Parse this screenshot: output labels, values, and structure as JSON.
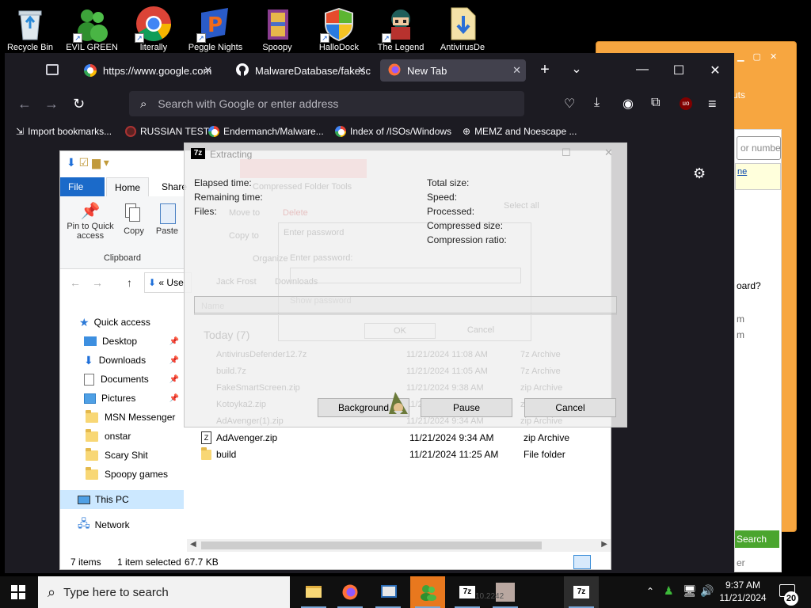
{
  "desktop": {
    "icons": [
      {
        "name": "Recycle Bin",
        "icon": "recycle-bin-icon"
      },
      {
        "name": "EVIL GREEN",
        "icon": "msn-buddy-icon"
      },
      {
        "name": "literally",
        "icon": "chrome-icon"
      },
      {
        "name": "Peggle Nights",
        "icon": "peggle-icon"
      },
      {
        "name": "Spoopy",
        "icon": "winrar-icon"
      },
      {
        "name": "HalloDock",
        "icon": "windows-shield-icon"
      },
      {
        "name": "The Legend",
        "icon": "game-character-icon"
      },
      {
        "name": "AntivirusDe",
        "icon": "download-file-icon"
      }
    ]
  },
  "right_app": {
    "input_placeholder": "or numbe",
    "text_fragments": [
      "uts",
      "oard?",
      "m",
      "m",
      "ne"
    ],
    "search_button": "Search",
    "footer": "er"
  },
  "firefox": {
    "tabs": [
      {
        "title": "https://www.google.com",
        "icon": "google-icon",
        "active": false
      },
      {
        "title": "MalwareDatabase/fakesc",
        "icon": "github-icon",
        "active": false
      },
      {
        "title": "New Tab",
        "icon": "firefox-icon",
        "active": true
      }
    ],
    "url_placeholder": "Search with Google or enter address",
    "bookmarks": [
      {
        "label": "Import bookmarks...",
        "icon": "import-icon"
      },
      {
        "label": "RUSSIAN TEST",
        "icon": "generic-site-icon"
      },
      {
        "label": "Endermanch/Malware...",
        "icon": "google-icon"
      },
      {
        "label": "Index of /ISOs/Windows",
        "icon": "google-icon"
      },
      {
        "label": "MEMZ and Noescape ...",
        "icon": "globe-icon"
      }
    ]
  },
  "explorer": {
    "ribbon_tabs": [
      "File",
      "Home",
      "Share"
    ],
    "clipboard": {
      "pin_label": "Pin to Quick access",
      "copy_label": "Copy",
      "paste_label": "Paste",
      "group_label": "Clipboard"
    },
    "address_partial": "Use",
    "nav": {
      "quick_access": "Quick access",
      "items": [
        {
          "label": "Desktop",
          "pinned": true,
          "icon": "desktop-folder-icon"
        },
        {
          "label": "Downloads",
          "pinned": true,
          "icon": "downloads-folder-icon"
        },
        {
          "label": "Documents",
          "pinned": true,
          "icon": "documents-folder-icon"
        },
        {
          "label": "Pictures",
          "pinned": true,
          "icon": "pictures-folder-icon"
        },
        {
          "label": "MSN Messenger",
          "pinned": false,
          "icon": "folder-icon"
        },
        {
          "label": "onstar",
          "pinned": false,
          "icon": "folder-icon"
        },
        {
          "label": "Scary Shit",
          "pinned": false,
          "icon": "folder-icon"
        },
        {
          "label": "Spoopy games",
          "pinned": false,
          "icon": "folder-icon"
        }
      ],
      "this_pc": "This PC",
      "network": "Network"
    },
    "files": [
      {
        "name": "AdAvenger.zip",
        "date": "11/21/2024 9:34 AM",
        "type": "zip Archive",
        "icon": "zip-icon"
      },
      {
        "name": "build",
        "date": "11/21/2024 11:25 AM",
        "type": "File folder",
        "icon": "folder-icon"
      }
    ],
    "status": {
      "items": "7 items",
      "selected": "1 item selected",
      "size": "67.7 KB"
    }
  },
  "ghost_layer": {
    "compressed_tools": "Compressed Folder Tools",
    "move_to": "Move to",
    "delete": "Delete",
    "copy_to": "Copy to",
    "organize": "Organize",
    "select_all": "Select all",
    "path": [
      "Jack Frost",
      "Downloads"
    ],
    "column_name": "Name",
    "group": "Today (7)",
    "rows": [
      {
        "name": "AntivirusDefender12.7z",
        "date": "11/21/2024 11:08 AM",
        "type": "7z Archive"
      },
      {
        "name": "build.7z",
        "date": "11/21/2024 11:05 AM",
        "type": "7z Archive"
      },
      {
        "name": "FakeSmartScreen.zip",
        "date": "11/21/2024 9:38 AM",
        "type": "zip Archive"
      },
      {
        "name": "Kotoyka2.zip",
        "date": "11/21/2024 9:36 AM",
        "type": "zip Archive"
      },
      {
        "name": "AdAvenger(1).zip",
        "date": "11/21/2024 9:34 AM",
        "type": "zip Archive"
      }
    ],
    "password_dialog": {
      "title": "Enter password",
      "field_label": "Enter password:",
      "show": "Show password",
      "ok": "OK",
      "cancel": "Cancel"
    }
  },
  "sevenzip": {
    "title": "Extracting",
    "logo": "7z",
    "left_labels": [
      "Elapsed time:",
      "Remaining time:",
      "Files:"
    ],
    "right_labels": [
      "Total size:",
      "Speed:",
      "Processed:",
      "Compressed size:",
      "Compression ratio:"
    ],
    "buttons": {
      "background": "Background",
      "pause": "Pause",
      "cancel": "Cancel"
    }
  },
  "taskbar": {
    "search_placeholder": "Type here to search",
    "time": "9:37 AM",
    "date": "11/21/2024",
    "notification_count": "20",
    "ghost_text": "10.2242"
  }
}
